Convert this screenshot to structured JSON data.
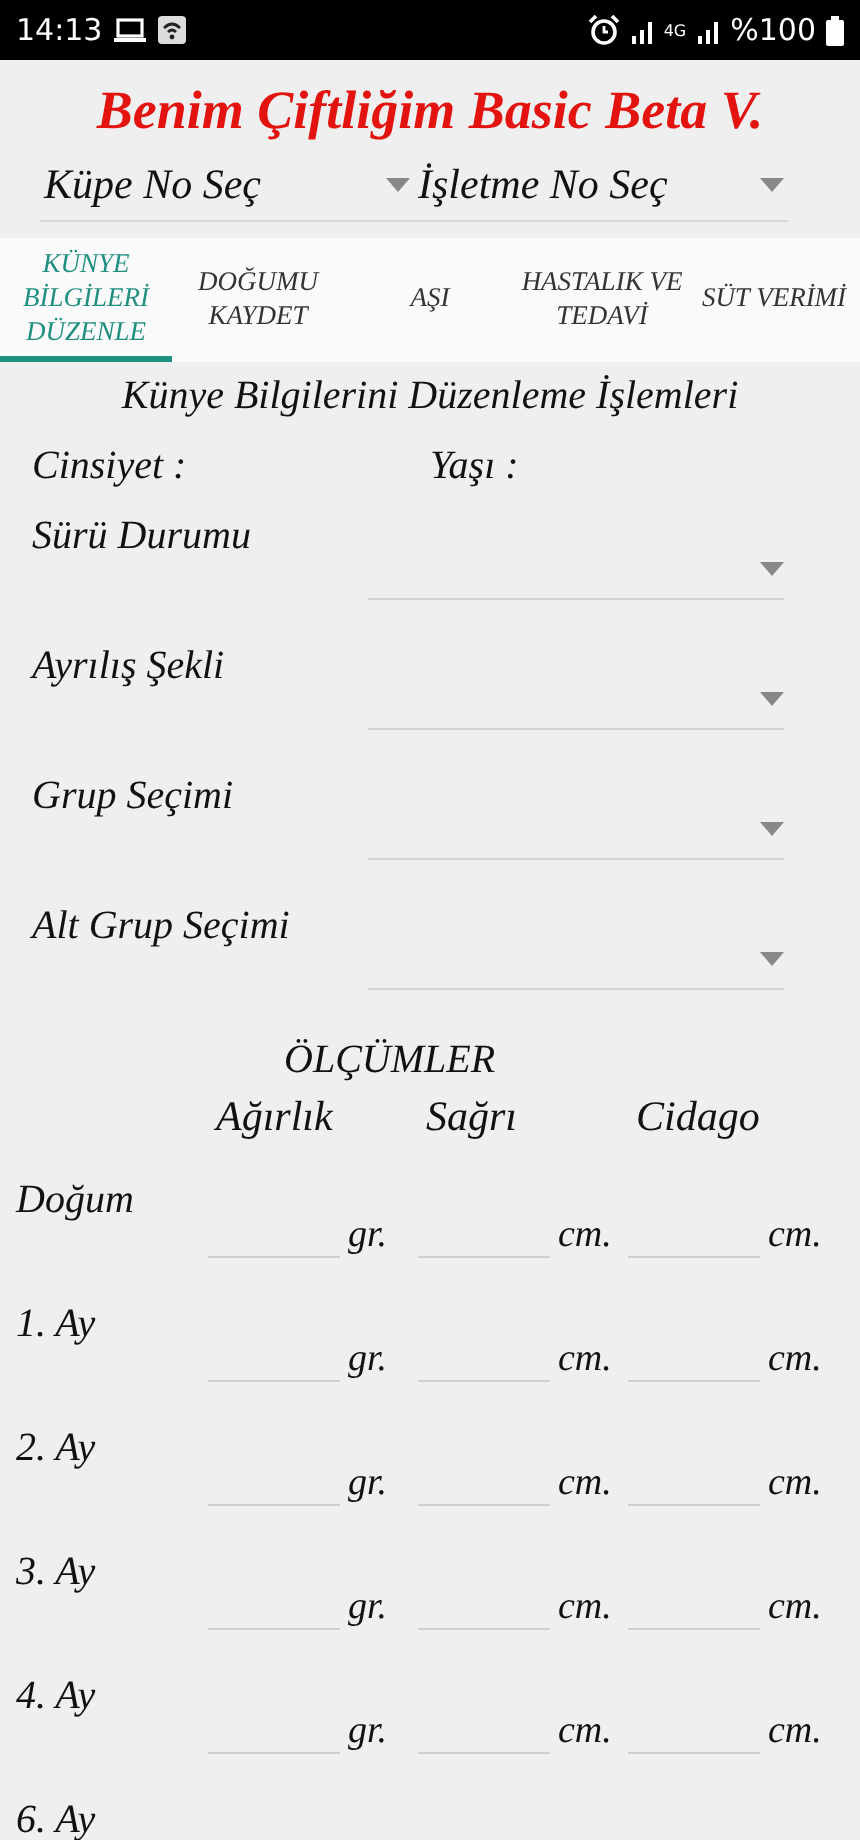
{
  "status_bar": {
    "time": "14:13",
    "network": "4G",
    "battery": "%100"
  },
  "app_title": "Benim Çiftliğim Basic Beta V.",
  "selectors": [
    {
      "label": "Küpe No Seç"
    },
    {
      "label": "İşletme No Seç"
    }
  ],
  "tabs": [
    {
      "label": "KÜNYE BİLGİLERİ DÜZENLE",
      "selected": true
    },
    {
      "label": "DOĞUMU KAYDET",
      "selected": false
    },
    {
      "label": "AŞI",
      "selected": false
    },
    {
      "label": "HASTALIK VE TEDAVİ",
      "selected": false
    },
    {
      "label": "SÜT VERİMİ",
      "selected": false
    }
  ],
  "section_title": "Künye Bilgilerini Düzenleme İşlemleri",
  "info": [
    {
      "label": "Cinsiyet :"
    },
    {
      "label": "Yaşı :"
    }
  ],
  "dropdowns": [
    {
      "label": "Sürü Durumu"
    },
    {
      "label": "Ayrılış Şekli"
    },
    {
      "label": "Grup Seçimi"
    },
    {
      "label": "Alt Grup Seçimi"
    }
  ],
  "measurements": {
    "title": "ÖLÇÜMLER",
    "columns": [
      "Ağırlık",
      "Sağrı",
      "Cidago"
    ],
    "rows": [
      {
        "label": "Doğum",
        "units": [
          "gr.",
          "cm.",
          "cm."
        ]
      },
      {
        "label": "1. Ay",
        "units": [
          "gr.",
          "cm.",
          "cm."
        ]
      },
      {
        "label": "2. Ay",
        "units": [
          "gr.",
          "cm.",
          "cm."
        ]
      },
      {
        "label": "3. Ay",
        "units": [
          "gr.",
          "cm.",
          "cm."
        ]
      },
      {
        "label": "4. Ay",
        "units": [
          "gr.",
          "cm.",
          "cm."
        ]
      },
      {
        "label": "6. Ay",
        "units": []
      }
    ]
  }
}
